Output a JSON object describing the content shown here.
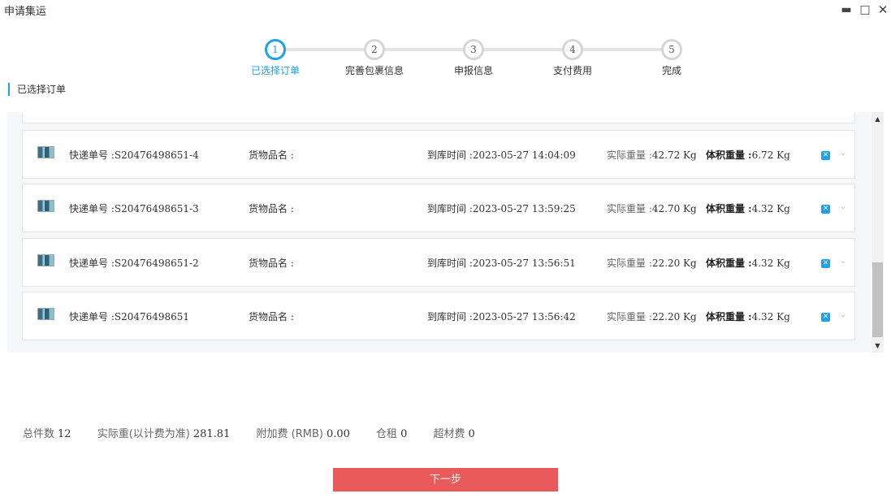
{
  "window": {
    "title": "申请集运",
    "minimize_icon": "minimize-icon",
    "maximize_icon": "maximize-icon",
    "close_icon": "close-icon"
  },
  "steps": [
    {
      "number": "1",
      "label": "已选择订单",
      "active": true
    },
    {
      "number": "2",
      "label": "完善包裹信息",
      "active": false
    },
    {
      "number": "3",
      "label": "申报信息",
      "active": false
    },
    {
      "number": "4",
      "label": "支付费用",
      "active": false
    },
    {
      "number": "5",
      "label": "完成",
      "active": false
    }
  ],
  "section_title": "已选择订单",
  "accent_color": "#1aa3ec",
  "orders": [
    {
      "tracking_label": "快递单号 :",
      "tracking_no": "S20476498651-4",
      "goods_label": "货物品名 :",
      "goods_name": "",
      "arrival_label": "到库时间 :",
      "arrival_time": "2023-05-27 14:04:09",
      "weight_label": "实际重量 :",
      "weight": "42.72 Kg",
      "volume_label": "体积重量 :",
      "volume_weight": "6.72 Kg"
    },
    {
      "tracking_label": "快递单号 :",
      "tracking_no": "S20476498651-3",
      "goods_label": "货物品名 :",
      "goods_name": "",
      "arrival_label": "到库时间 :",
      "arrival_time": "2023-05-27 13:59:25",
      "weight_label": "实际重量 :",
      "weight": "42.70 Kg",
      "volume_label": "体积重量 :",
      "volume_weight": "4.32 Kg"
    },
    {
      "tracking_label": "快递单号 :",
      "tracking_no": "S20476498651-2",
      "goods_label": "货物品名 :",
      "goods_name": "",
      "arrival_label": "到库时间 :",
      "arrival_time": "2023-05-27 13:56:51",
      "weight_label": "实际重量 :",
      "weight": "22.20 Kg",
      "volume_label": "体积重量 :",
      "volume_weight": "4.32 Kg"
    },
    {
      "tracking_label": "快递单号 :",
      "tracking_no": "S20476498651",
      "goods_label": "货物品名 :",
      "goods_name": "",
      "arrival_label": "到库时间 :",
      "arrival_time": "2023-05-27 13:56:42",
      "weight_label": "实际重量 :",
      "weight": "22.20 Kg",
      "volume_label": "体积重量 :",
      "volume_weight": "4.32 Kg"
    }
  ],
  "summary": {
    "total_count_label": "总件数",
    "total_count": "12",
    "actual_weight_label": "实际重(以计费为准)",
    "actual_weight": "281.81",
    "surcharge_label": "附加费 (RMB)",
    "surcharge": "0.00",
    "storage_label": "仓租",
    "storage": "0",
    "oversize_label": "超材费",
    "oversize": "0"
  },
  "next_button": "下一步",
  "next_button_color": "#e95a5a"
}
